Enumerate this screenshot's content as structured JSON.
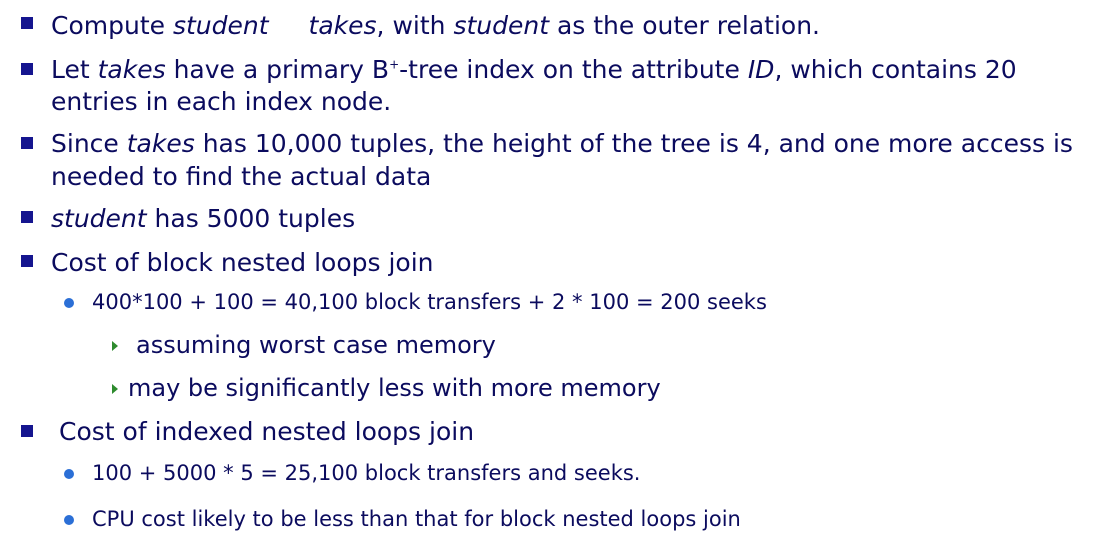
{
  "items": [
    {
      "seg1": "Compute ",
      "seg2": "student",
      "seg3": "takes",
      "seg4": ", with ",
      "seg5": "student",
      "seg6": " as the outer relation."
    },
    {
      "seg1": "Let ",
      "seg2": "takes",
      "seg3": " have a primary B",
      "sup": "+",
      "seg4": "-tree index on the attribute ",
      "seg5": "ID",
      "seg6": ", which contains 20",
      "line2": "entries in each index node."
    },
    {
      "seg1": "Since ",
      "seg2": "takes",
      "seg3": " has 10,000 tuples, the height of the tree is 4, and one more access is",
      "line2": "needed to find the actual data"
    },
    {
      "seg1": "student",
      "seg2": " has 5000 tuples"
    },
    {
      "text": "Cost of block nested loops join",
      "sub": {
        "text": "400*100 + 100 =  40,100 block transfers + 2 * 100 = 200 seeks",
        "subsub": [
          "assuming worst case memory",
          "may be significantly less with more memory"
        ]
      }
    },
    {
      "text": "Cost of indexed nested loops join",
      "sub": [
        "100 + 5000 * 5 = 25,100  block transfers and seeks.",
        "CPU cost likely to be less than that for block nested loops join"
      ]
    }
  ]
}
